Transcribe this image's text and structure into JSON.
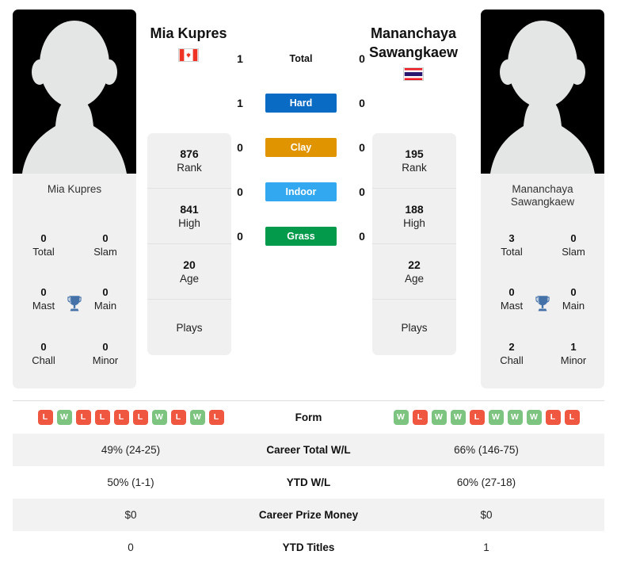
{
  "players": {
    "left": {
      "name": "Mia Kupres",
      "photo_name": "Mia Kupres",
      "country": "Canada",
      "flag": "canada-flag",
      "titles": [
        {
          "value": "0",
          "label": "Total"
        },
        {
          "value": "0",
          "label": "Slam"
        },
        {
          "value": "0",
          "label": "Mast"
        },
        {
          "value": "0",
          "label": "Main"
        },
        {
          "value": "0",
          "label": "Chall"
        },
        {
          "value": "0",
          "label": "Minor"
        }
      ],
      "stats": [
        {
          "value": "876",
          "label": "Rank"
        },
        {
          "value": "841",
          "label": "High"
        },
        {
          "value": "20",
          "label": "Age"
        },
        {
          "value": "",
          "label": "Plays"
        }
      ],
      "form": [
        "L",
        "W",
        "L",
        "L",
        "L",
        "L",
        "W",
        "L",
        "W",
        "L"
      ],
      "career_total_wl": "49% (24-25)",
      "ytd_wl": "50% (1-1)",
      "career_prize_money": "$0",
      "ytd_titles": "0"
    },
    "right": {
      "name": "Mananchaya\nSawangkaew",
      "photo_name": "Mananchaya\nSawangkaew",
      "country": "Thailand",
      "flag": "thailand-flag",
      "titles": [
        {
          "value": "3",
          "label": "Total"
        },
        {
          "value": "0",
          "label": "Slam"
        },
        {
          "value": "0",
          "label": "Mast"
        },
        {
          "value": "0",
          "label": "Main"
        },
        {
          "value": "2",
          "label": "Chall"
        },
        {
          "value": "1",
          "label": "Minor"
        }
      ],
      "stats": [
        {
          "value": "195",
          "label": "Rank"
        },
        {
          "value": "188",
          "label": "High"
        },
        {
          "value": "22",
          "label": "Age"
        },
        {
          "value": "",
          "label": "Plays"
        }
      ],
      "form": [
        "W",
        "L",
        "W",
        "W",
        "L",
        "W",
        "W",
        "W",
        "L",
        "L"
      ],
      "career_total_wl": "66% (146-75)",
      "ytd_wl": "60% (27-18)",
      "career_prize_money": "$0",
      "ytd_titles": "1"
    }
  },
  "head_to_head": [
    {
      "label": "Total",
      "left": "1",
      "right": "0",
      "style": "plain",
      "color": ""
    },
    {
      "label": "Hard",
      "left": "1",
      "right": "0",
      "style": "chip",
      "color": "#0a6bc4"
    },
    {
      "label": "Clay",
      "left": "0",
      "right": "0",
      "style": "chip",
      "color": "#e09400"
    },
    {
      "label": "Indoor",
      "left": "0",
      "right": "0",
      "style": "chip",
      "color": "#31a8f0"
    },
    {
      "label": "Grass",
      "left": "0",
      "right": "0",
      "style": "chip",
      "color": "#039b4b"
    }
  ],
  "table": {
    "rows": [
      {
        "label": "Form",
        "left": "",
        "right": "",
        "type": "form"
      },
      {
        "label": "Career Total W/L",
        "left": "49% (24-25)",
        "right": "66% (146-75)",
        "type": "text"
      },
      {
        "label": "YTD W/L",
        "left": "50% (1-1)",
        "right": "60% (27-18)",
        "type": "text"
      },
      {
        "label": "Career Prize Money",
        "left": "$0",
        "right": "$0",
        "type": "text"
      },
      {
        "label": "YTD Titles",
        "left": "0",
        "right": "1",
        "type": "text"
      }
    ]
  },
  "colors": {
    "hard": "#0a6bc4",
    "clay": "#e09400",
    "indoor": "#31a8f0",
    "grass": "#039b4b",
    "win": "#7cc47f",
    "loss": "#ef5740",
    "trophy": "#4472a8",
    "card_bg": "#f0f0f0"
  }
}
